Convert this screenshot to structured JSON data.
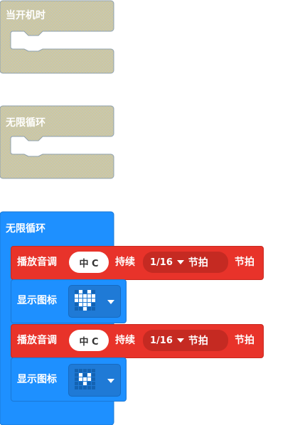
{
  "hat_blocks": [
    {
      "label": "当开机时",
      "color": "#cfc7a0"
    },
    {
      "label": "无限循环",
      "color": "#cfc7a0"
    }
  ],
  "main_loop": {
    "label": "无限循环",
    "color": "#1e90ff",
    "statements": [
      {
        "type": "play_tone",
        "label": "播放音调",
        "note": "中 C",
        "duration_label": "持续",
        "beat_value": "1/16",
        "beat_unit_inner": "节拍",
        "beat_unit_outer": "节拍",
        "color": "#e8332a"
      },
      {
        "type": "show_icon",
        "label": "显示图标",
        "icon": "heart-icon",
        "pattern": [
          0,
          1,
          0,
          1,
          0,
          1,
          1,
          1,
          1,
          1,
          1,
          1,
          1,
          1,
          1,
          0,
          1,
          1,
          1,
          0,
          0,
          0,
          1,
          0,
          0
        ],
        "color": "#1e90ff"
      },
      {
        "type": "play_tone",
        "label": "播放音调",
        "note": "中 C",
        "duration_label": "持续",
        "beat_value": "1/16",
        "beat_unit_inner": "节拍",
        "beat_unit_outer": "节拍",
        "color": "#e8332a"
      },
      {
        "type": "show_icon",
        "label": "显示图标",
        "icon": "small-heart-icon",
        "pattern": [
          0,
          0,
          0,
          0,
          0,
          0,
          1,
          0,
          1,
          0,
          0,
          1,
          1,
          1,
          0,
          0,
          0,
          1,
          0,
          0,
          0,
          0,
          0,
          0,
          0
        ],
        "color": "#1e90ff"
      }
    ]
  }
}
